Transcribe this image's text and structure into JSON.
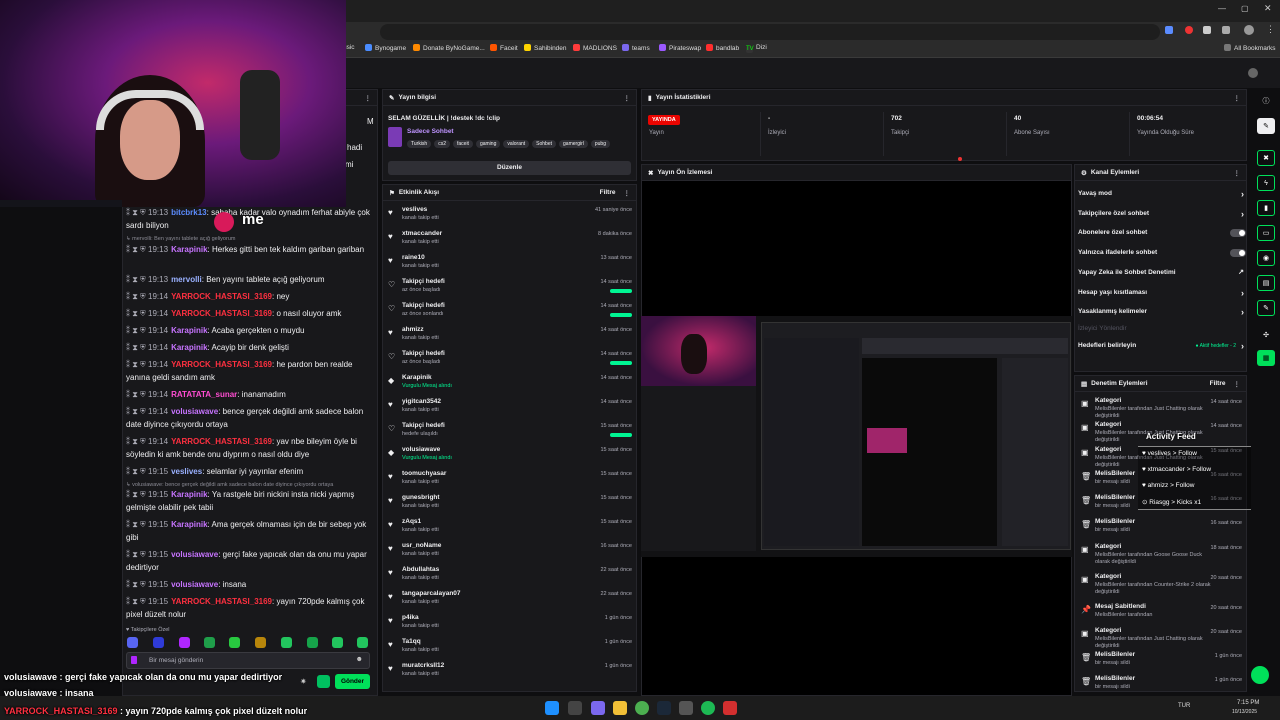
{
  "bookmarks": [
    "usic",
    "Bynogame",
    "Donate ByNoGame...",
    "Faceit",
    "Sahibinden",
    "MADLIONS",
    "teams",
    "Pirateswap",
    "bandlab",
    "Dizi",
    "All Bookmarks"
  ],
  "webcam_overlay_text": "me",
  "chat": {
    "lines": [
      {
        "ts": "19:13",
        "user": "bitcbrk13",
        "color": "#5c8cff",
        "text": ": sabaha kadar valo oynadım ferhat abiyle çok sardı biliyon"
      },
      {
        "ts": "19:13",
        "user": "Karapinik",
        "color": "#c774ff",
        "text": ": Herkes gitti ben tek kaldım gariban gariban"
      },
      {
        "ts": "19:13",
        "user": "mervolli",
        "color": "#9ab1ff",
        "text": ": Ben yayını tablete açığ geliyorum"
      },
      {
        "ts": "19:14",
        "user": "YARROCK_HASTASI_3169",
        "color": "#ff3040",
        "text": ": ney"
      },
      {
        "ts": "19:14",
        "user": "YARROCK_HASTASI_3169",
        "color": "#ff3040",
        "text": ": o nasıl oluyor amk"
      },
      {
        "ts": "19:14",
        "user": "Karapinik",
        "color": "#c774ff",
        "text": ": Acaba gerçekten o muydu"
      },
      {
        "ts": "19:14",
        "user": "Karapinik",
        "color": "#c774ff",
        "text": ": Acayip bir denk gelişti"
      },
      {
        "ts": "19:14",
        "user": "YARROCK_HASTASI_3169",
        "color": "#ff3040",
        "text": ": he pardon ben realde yanına geldi sandım amk"
      },
      {
        "ts": "19:14",
        "user": "RATATATA_sunar",
        "color": "#ff4dd2",
        "text": ": inanamadım"
      },
      {
        "ts": "19:14",
        "user": "volusiawave",
        "color": "#c774ff",
        "text": ": bence gerçek değildi amk sadece balon date diyince çıkıyordu ortaya"
      },
      {
        "ts": "19:14",
        "user": "YARROCK_HASTASI_3169",
        "color": "#ff3040",
        "text": ": yav nbe bileyim öyle bi söyledin ki amk bende onu diyprım o nasıl oldu diye"
      },
      {
        "ts": "19:15",
        "user": "veslives",
        "color": "#9ab1ff",
        "text": ": selamlar iyi yayınlar efenim"
      },
      {
        "ts": "19:15",
        "user": "Karapinik",
        "color": "#c774ff",
        "text": ": Ya rastgele biri nickini insta nicki yapmış gelmişte olabilir pek tabii"
      },
      {
        "ts": "19:15",
        "user": "Karapinik",
        "color": "#c774ff",
        "text": ": Ama gerçek olmaması için de bir sebep yok gibi"
      },
      {
        "ts": "19:15",
        "user": "volusiawave",
        "color": "#c774ff",
        "text": ": gerçi fake yapıcak olan da onu mu yapar dedirtiyor"
      },
      {
        "ts": "19:15",
        "user": "volusiawave",
        "color": "#c774ff",
        "text": ": insana"
      },
      {
        "ts": "19:15",
        "user": "YARROCK_HASTASI_3169",
        "color": "#ff3040",
        "text": ": yayın 720pde kalmış çok pixel düzelt nolur"
      }
    ],
    "system1": "↳ mervolli: Ben yayını tablete açığ geliyorum",
    "system2": "↳ volusiawave: bence gerçek değildi amk sadece balon date diyince çıkıyordu ortaya",
    "followers_only": "Takipçilere Özel",
    "input_placeholder": "Bir mesaj gönderin",
    "send": "Gönder",
    "side_fragments": [
      "M",
      "hadi",
      "mi"
    ]
  },
  "stream_info": {
    "header": "Yayın bilgisi",
    "title": "SELAM GÜZELLİK | !destek !dc !clip",
    "category": "Sadece Sohbet",
    "tags": [
      "Turkish",
      "cs2",
      "faceit",
      "gaming",
      "valorant",
      "Sohbet",
      "gamergirl",
      "pubg"
    ],
    "edit": "Düzenle"
  },
  "activity": {
    "header": "Etkinlik Akışı",
    "filter": "Filtre",
    "events": [
      {
        "icon": "♥",
        "name": "veslives",
        "sub": "kanalı takip etti",
        "time": "41 saniye önce",
        "green": false,
        "bar": false
      },
      {
        "icon": "♥",
        "name": "xtmaccander",
        "sub": "kanalı takip etti",
        "time": "8 dakika önce",
        "green": false,
        "bar": false
      },
      {
        "icon": "♥",
        "name": "raine10",
        "sub": "kanalı takip etti",
        "time": "13 saat önce",
        "green": false,
        "bar": false
      },
      {
        "icon": "♡",
        "name": "Takipçi hedefi",
        "sub": "az önce başladı",
        "time": "14 saat önce",
        "green": false,
        "bar": true
      },
      {
        "icon": "♡",
        "name": "Takipçi hedefi",
        "sub": "az önce sonlandı",
        "time": "14 saat önce",
        "green": false,
        "bar": true
      },
      {
        "icon": "♥",
        "name": "ahmizz",
        "sub": "kanalı takip etti",
        "time": "14 saat önce",
        "green": false,
        "bar": false
      },
      {
        "icon": "♡",
        "name": "Takipçi hedefi",
        "sub": "az önce başladı",
        "time": "14 saat önce",
        "green": false,
        "bar": true
      },
      {
        "icon": "◆",
        "name": "Karapinik",
        "sub": "Vurgulu Mesaj alındı",
        "time": "14 saat önce",
        "green": true,
        "bar": false
      },
      {
        "icon": "♥",
        "name": "yigitcan3542",
        "sub": "kanalı takip etti",
        "time": "14 saat önce",
        "green": false,
        "bar": false
      },
      {
        "icon": "♡",
        "name": "Takipçi hedefi",
        "sub": "hedefe ulaşıldı",
        "time": "15 saat önce",
        "green": false,
        "bar": true
      },
      {
        "icon": "◆",
        "name": "volusiawave",
        "sub": "Vurgulu Mesaj alındı",
        "time": "15 saat önce",
        "green": true,
        "bar": false
      },
      {
        "icon": "♥",
        "name": "toomuchyasar",
        "sub": "kanalı takip etti",
        "time": "15 saat önce",
        "green": false,
        "bar": false
      },
      {
        "icon": "♥",
        "name": "gunesbright",
        "sub": "kanalı takip etti",
        "time": "15 saat önce",
        "green": false,
        "bar": false
      },
      {
        "icon": "♥",
        "name": "zAqs1",
        "sub": "kanalı takip etti",
        "time": "15 saat önce",
        "green": false,
        "bar": false
      },
      {
        "icon": "♥",
        "name": "usr_noName",
        "sub": "kanalı takip etti",
        "time": "16 saat önce",
        "green": false,
        "bar": false
      },
      {
        "icon": "♥",
        "name": "Abdullahtas",
        "sub": "kanalı takip etti",
        "time": "22 saat önce",
        "green": false,
        "bar": false
      },
      {
        "icon": "♥",
        "name": "tangaparcalayan07",
        "sub": "kanalı takip etti",
        "time": "22 saat önce",
        "green": false,
        "bar": false
      },
      {
        "icon": "♥",
        "name": "p4ika",
        "sub": "kanalı takip etti",
        "time": "1 gün önce",
        "green": false,
        "bar": false
      },
      {
        "icon": "♥",
        "name": "Ta1qq",
        "sub": "kanalı takip etti",
        "time": "1 gün önce",
        "green": false,
        "bar": false
      },
      {
        "icon": "♥",
        "name": "muratcrksll12",
        "sub": "kanalı takip etti",
        "time": "1 gün önce",
        "green": false,
        "bar": false
      }
    ]
  },
  "stats": {
    "header": "Yayın İstatistikleri",
    "live": "YAYINDA",
    "items": [
      {
        "value": "",
        "label": "Yayın"
      },
      {
        "value": "-",
        "label": "İzleyici"
      },
      {
        "value": "702",
        "label": "Takipçi"
      },
      {
        "value": "40",
        "label": "Abone Sayısı"
      },
      {
        "value": "00:06:54",
        "label": "Yayında Olduğu Süre"
      }
    ]
  },
  "preview": {
    "header": "Yayın Ön İzlemesi"
  },
  "channel_actions": {
    "header": "Kanal Eylemleri",
    "rows": [
      {
        "label": "Yavaş mod",
        "type": "arrow"
      },
      {
        "label": "Takipçilere özel sohbet",
        "type": "arrow"
      },
      {
        "label": "Abonelere özel sohbet",
        "type": "toggle"
      },
      {
        "label": "Yalnızca ifadelerle sohbet",
        "type": "toggle"
      },
      {
        "label": "Yapay Zeka ile Sohbet Denetimi",
        "type": "ext"
      },
      {
        "label": "Hesap yaşı kısıtlaması",
        "type": "arrow"
      },
      {
        "label": "Yasaklanmış kelimeler",
        "type": "arrow"
      },
      {
        "label": "İzleyici Yönlendir",
        "type": "none"
      },
      {
        "label": "Hedefleri belirleyin",
        "type": "goal"
      }
    ],
    "goal_status": "● Aktif hedefler - 2"
  },
  "mod_actions": {
    "header": "Denetim Eylemleri",
    "filter": "Filtre",
    "items": [
      {
        "icon": "▣",
        "title": "Kategori",
        "sub": "MelisBilenler tarafından Just Chatting olarak değiştirildi",
        "time": "14 saat önce"
      },
      {
        "icon": "▣",
        "title": "Kategori",
        "sub": "MelisBilenler tarafından Just Chatting olarak değiştirildi",
        "time": "14 saat önce"
      },
      {
        "icon": "▣",
        "title": "Kategori",
        "sub": "MelisBilenler tarafından Just Chatting olarak değiştirildi",
        "time": "15 saat önce"
      },
      {
        "icon": "🗑",
        "title": "MelisBilenler",
        "sub": "bir mesajı sildi",
        "time": "16 saat önce"
      },
      {
        "icon": "🗑",
        "title": "MelisBilenler",
        "sub": "bir mesajı sildi",
        "time": "16 saat önce"
      },
      {
        "icon": "🗑",
        "title": "MelisBilenler",
        "sub": "bir mesajı sildi",
        "time": "16 saat önce"
      },
      {
        "icon": "▣",
        "title": "Kategori",
        "sub": "MelisBilenler tarafından Goose Goose Duck olarak değiştirildi",
        "time": "18 saat önce"
      },
      {
        "icon": "▣",
        "title": "Kategori",
        "sub": "MelisBilenler tarafından Counter-Strike 2 olarak değiştirildi",
        "time": "20 saat önce"
      },
      {
        "icon": "📌",
        "title": "Mesaj Sabitlendi",
        "sub": "MelisBilenler tarafından",
        "time": "20 saat önce"
      },
      {
        "icon": "▣",
        "title": "Kategori",
        "sub": "MelisBilenler tarafından Just Chatting olarak değiştirildi",
        "time": "20 saat önce"
      },
      {
        "icon": "🗑",
        "title": "MelisBilenler",
        "sub": "bir mesajı sildi",
        "time": "1 gün önce"
      },
      {
        "icon": "🗑",
        "title": "MelisBilenler",
        "sub": "bir mesajı sildi",
        "time": "1 gün önce"
      }
    ]
  },
  "activity_feed": {
    "title": "Activity Feed",
    "items": [
      "veslives > Follow",
      "xtmaccander > Follow",
      "ahmizz > Follow",
      "Riasgg > Kicks x1"
    ]
  },
  "overlay_chat": [
    {
      "user": "volusiawave",
      "color": "#ffffff",
      "text": " : gerçi fake yapıcak olan da onu mu yapar dedirtiyor"
    },
    {
      "user": "volusiawave",
      "color": "#ffffff",
      "text": " : insana"
    },
    {
      "user": "YARROCK_HASTASI_3169",
      "color": "#ff3040",
      "text": " : yayın 720pde kalmış çok pixel düzelt nolur"
    }
  ],
  "tray": {
    "lang": "TUR",
    "time": "7:15 PM",
    "date": "10/13/2025"
  }
}
